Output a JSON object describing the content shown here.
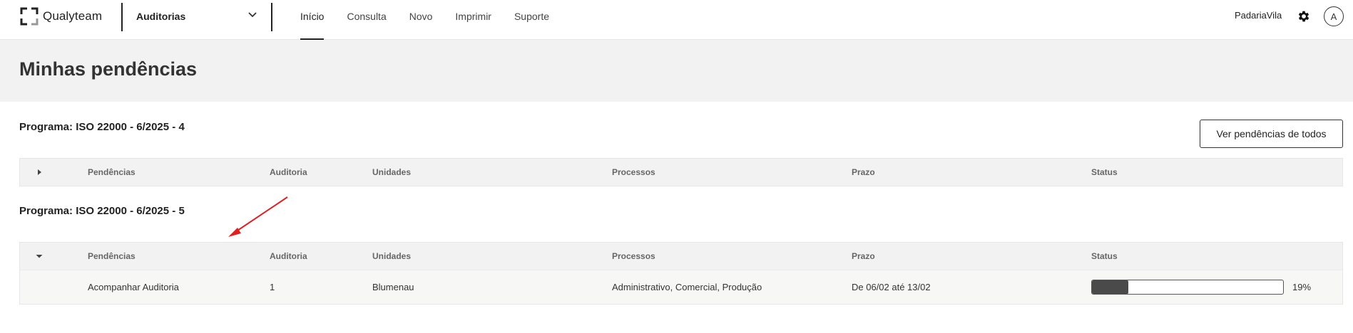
{
  "header": {
    "brand": "Qualyteam",
    "app_selector": "Auditorias",
    "nav": [
      "Início",
      "Consulta",
      "Novo",
      "Imprimir",
      "Suporte"
    ],
    "active_nav": "Início",
    "user": "PadariaVila",
    "avatar_initial": "A",
    "icons": {
      "logo": "qualyteam-logo-icon",
      "dropdown": "chevron-down-icon",
      "settings": "gear-icon"
    }
  },
  "page": {
    "title": "Minhas pendências"
  },
  "actions": {
    "view_all": "Ver pendências de todos"
  },
  "columns": [
    "Pendências",
    "Auditoria",
    "Unidades",
    "Processos",
    "Prazo",
    "Status"
  ],
  "programs": [
    {
      "title": "Programa: ISO 22000 - 6/2025 - 4",
      "expanded": false,
      "rows": []
    },
    {
      "title": "Programa: ISO 22000 - 6/2025 - 5",
      "expanded": true,
      "rows": [
        {
          "pendencia": "Acompanhar Auditoria",
          "auditoria": "1",
          "unidades": "Blumenau",
          "processos": "Administrativo, Comercial, Produção",
          "prazo": "De 06/02 até 13/02",
          "status_label": "19%",
          "status_progress": 0.19
        }
      ]
    }
  ],
  "colors": {
    "annotation_arrow": "#e02020",
    "progress_fill": "#4a4a4a",
    "band": "#f2f2f2"
  }
}
